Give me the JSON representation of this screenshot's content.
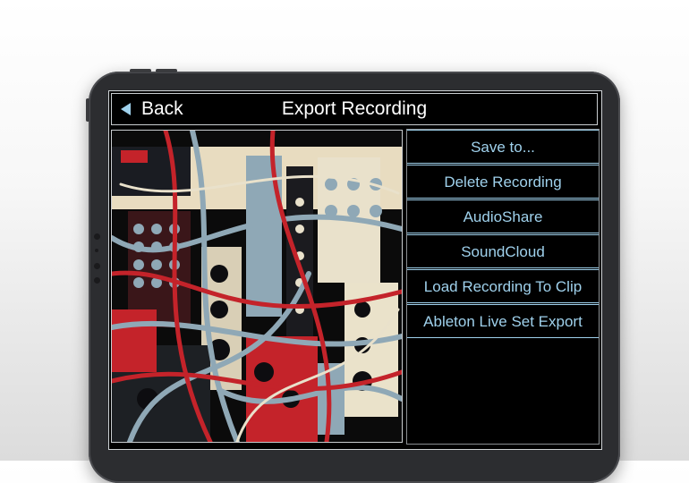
{
  "header": {
    "back_label": "Back",
    "title": "Export Recording"
  },
  "menu": {
    "items": [
      {
        "label": "Save to..."
      },
      {
        "label": "Delete Recording"
      },
      {
        "label": "AudioShare"
      },
      {
        "label": "SoundCloud"
      },
      {
        "label": "Load Recording To Clip"
      },
      {
        "label": "Ableton Live Set Export"
      }
    ]
  },
  "colors": {
    "accent": "#9fd1ec",
    "background": "#000000",
    "text": "#ffffff"
  },
  "image": {
    "subject": "modular synthesizer patch artwork"
  }
}
